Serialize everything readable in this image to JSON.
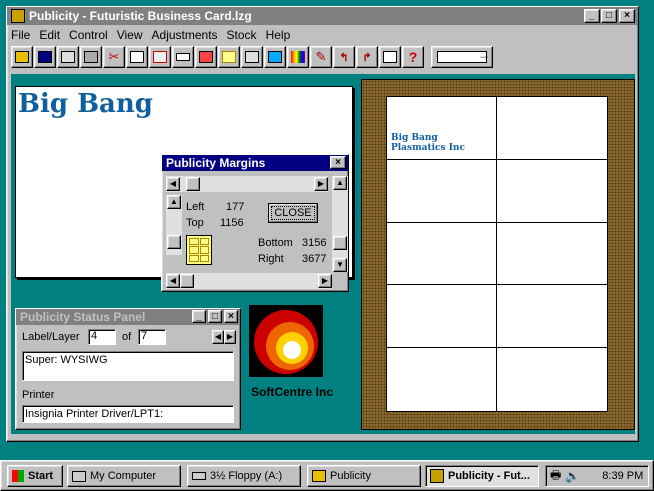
{
  "window": {
    "title": "Publicity - Futuristic Business Card.lzg"
  },
  "menu": [
    "File",
    "Edit",
    "Control",
    "View",
    "Adjustments",
    "Stock",
    "Help"
  ],
  "toolbar": {
    "icons": [
      "open-icon",
      "save-icon",
      "print-icon",
      "print-preview-icon",
      "cut-icon",
      "copy-icon",
      "paste-icon",
      "frame-icon",
      "copy-frame-icon",
      "grid-icon",
      "layout-icon",
      "border-icon",
      "rainbow-icon",
      "brush-icon",
      "rotate-icon",
      "flip-icon",
      "merge-icon",
      "help-icon",
      "arrow-icon"
    ]
  },
  "card": {
    "brand": "Big Bang",
    "sheet_line1": "Big Bang",
    "sheet_line2": "Plasmatics Inc"
  },
  "margins_dialog": {
    "title": "Publicity Margins",
    "left_label": "Left",
    "left_value": "177",
    "top_label": "Top",
    "top_value": "1156",
    "bottom_label": "Bottom",
    "bottom_value": "3156",
    "right_label": "Right",
    "right_value": "3677",
    "close_label": "CLOSE"
  },
  "status_panel": {
    "title": "Publicity Status Panel",
    "label_layer_label": "Label/Layer",
    "label_layer_value": "4",
    "of_label": "of",
    "of_value": "7",
    "super_text": "Super: WYSIWG",
    "printer_label": "Printer",
    "printer_value": "Insignia Printer Driver/LPT1:"
  },
  "logo": {
    "company": "SoftCentre Inc"
  },
  "taskbar": {
    "start": "Start",
    "items": [
      "My Computer",
      "3½ Floppy (A:)",
      "Publicity",
      "Publicity - Fut..."
    ],
    "time": "8:39 PM"
  }
}
